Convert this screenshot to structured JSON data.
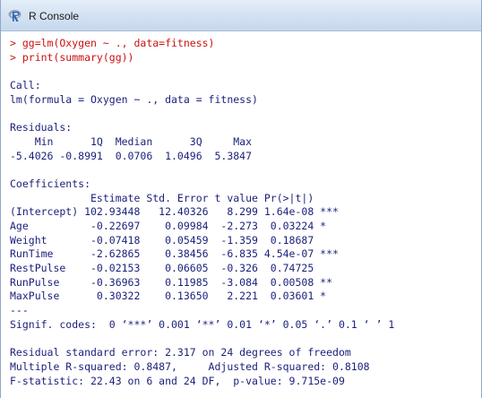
{
  "window": {
    "title": "R Console",
    "icon": "r-logo-icon"
  },
  "colors": {
    "command": "#cc1111",
    "output": "#1a1f7a",
    "titlebar": "#d5e3f3"
  },
  "console": {
    "lines": [
      {
        "type": "cmd",
        "text": "> gg=lm(Oxygen ~ ., data=fitness)"
      },
      {
        "type": "cmd",
        "text": "> print(summary(gg))"
      },
      {
        "type": "out",
        "text": ""
      },
      {
        "type": "out",
        "text": "Call:"
      },
      {
        "type": "out",
        "text": "lm(formula = Oxygen ~ ., data = fitness)"
      },
      {
        "type": "out",
        "text": ""
      },
      {
        "type": "out",
        "text": "Residuals:"
      },
      {
        "type": "out",
        "text": "    Min      1Q  Median      3Q     Max "
      },
      {
        "type": "out",
        "text": "-5.4026 -0.8991  0.0706  1.0496  5.3847 "
      },
      {
        "type": "out",
        "text": ""
      },
      {
        "type": "out",
        "text": "Coefficients:"
      },
      {
        "type": "out",
        "text": "             Estimate Std. Error t value Pr(>|t|)    "
      },
      {
        "type": "out",
        "text": "(Intercept) 102.93448   12.40326   8.299 1.64e-08 ***"
      },
      {
        "type": "out",
        "text": "Age          -0.22697    0.09984  -2.273  0.03224 *  "
      },
      {
        "type": "out",
        "text": "Weight       -0.07418    0.05459  -1.359  0.18687    "
      },
      {
        "type": "out",
        "text": "RunTime      -2.62865    0.38456  -6.835 4.54e-07 ***"
      },
      {
        "type": "out",
        "text": "RestPulse    -0.02153    0.06605  -0.326  0.74725    "
      },
      {
        "type": "out",
        "text": "RunPulse     -0.36963    0.11985  -3.084  0.00508 ** "
      },
      {
        "type": "out",
        "text": "MaxPulse      0.30322    0.13650   2.221  0.03601 *  "
      },
      {
        "type": "out",
        "text": "---"
      },
      {
        "type": "out",
        "text": "Signif. codes:  0 ‘***’ 0.001 ‘**’ 0.01 ‘*’ 0.05 ‘.’ 0.1 ‘ ’ 1 "
      },
      {
        "type": "out",
        "text": ""
      },
      {
        "type": "out",
        "text": "Residual standard error: 2.317 on 24 degrees of freedom"
      },
      {
        "type": "out",
        "text": "Multiple R-squared: 0.8487,     Adjusted R-squared: 0.8108 "
      },
      {
        "type": "out",
        "text": "F-statistic: 22.43 on 6 and 24 DF,  p-value: 9.715e-09 "
      }
    ]
  }
}
